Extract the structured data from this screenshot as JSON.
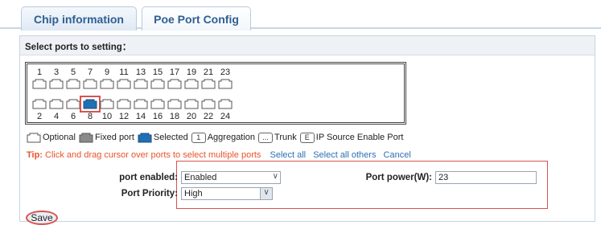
{
  "tabs": [
    {
      "label": "Chip information"
    },
    {
      "label": "Poe Port Config"
    }
  ],
  "panel": {
    "title": "Select ports to setting："
  },
  "ports": {
    "top_numbers": [
      "1",
      "3",
      "5",
      "7",
      "9",
      "11",
      "13",
      "15",
      "17",
      "19",
      "21",
      "23"
    ],
    "bottom_numbers": [
      "2",
      "4",
      "6",
      "8",
      "10",
      "12",
      "14",
      "16",
      "18",
      "20",
      "22",
      "24"
    ],
    "selected": "8"
  },
  "legend": {
    "optional": "Optional",
    "fixed": "Fixed port",
    "selected": "Selected",
    "aggregation_badge": "1",
    "aggregation": "Aggregation",
    "trunk_badge": "...",
    "trunk": "Trunk",
    "ipsource_badge": "E",
    "ipsource": "IP Source Enable Port"
  },
  "tip": {
    "label": "Tip:",
    "text": "Click and drag cursor over ports to select multiple ports",
    "select_all": "Select all",
    "select_others": "Select all others",
    "cancel": "Cancel"
  },
  "form": {
    "port_enabled_label": "port enabled:",
    "port_enabled_value": "Enabled",
    "port_power_label": "Port power(W):",
    "port_power_value": "23",
    "priority_label": "Port Priority:",
    "priority_value": "High"
  },
  "save_label": "Save",
  "colors": {
    "accent": "#2e5f92",
    "selected_port": "#1f6fb3",
    "tip": "#e8542a",
    "highlight": "#d9534f"
  }
}
